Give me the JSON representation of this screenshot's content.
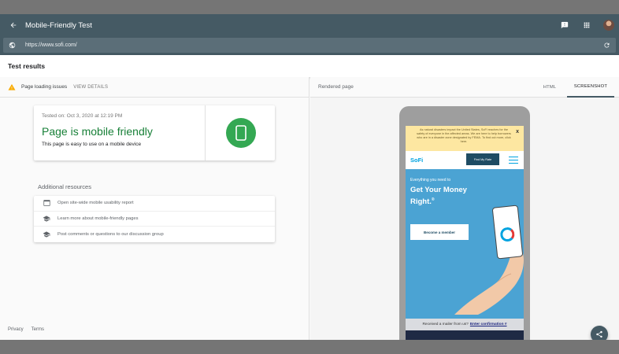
{
  "header": {
    "title": "Mobile-Friendly Test",
    "url": "https://www.sofi.com/"
  },
  "results": {
    "title": "Test results",
    "issues_label": "Page loading issues",
    "view_details": "VIEW DETAILS"
  },
  "card": {
    "tested_on": "Tested on: Oct 3, 2020 at 12:19 PM",
    "status": "Page is mobile friendly",
    "subtitle": "This page is easy to use on a mobile device",
    "status_color": "#188038",
    "icon_color": "#34a853"
  },
  "additional": {
    "title": "Additional resources",
    "items": [
      {
        "icon": "browser-window-icon",
        "label": "Open site-wide mobile usability report"
      },
      {
        "icon": "school-cap-icon",
        "label": "Learn more about mobile-friendly pages"
      },
      {
        "icon": "school-cap-icon",
        "label": "Post comments or questions to our discussion group"
      }
    ]
  },
  "footer": {
    "privacy": "Privacy",
    "terms": "Terms"
  },
  "rendered": {
    "title": "Rendered page",
    "tab_html": "HTML",
    "tab_screenshot": "SCREENSHOT"
  },
  "screenshot": {
    "banner": "As natural disasters impact the United States, SoFi reaches for the safety of everyone in the affected areas. We are here to help borrowers who are in a disaster zone designated by FEMA. To find out more, click here.",
    "banner_close": "x",
    "logo": "SoFi",
    "rate_button": "Find My Rate",
    "hero_small": "Everything you need to",
    "hero_big": "Get Your Money Right.",
    "hero_mark": "®",
    "member_button": "Become a member",
    "mailer_text": "Received a mailer from us?",
    "mailer_link": "Enter confirmation #",
    "hero_color": "#4ba3d3"
  }
}
